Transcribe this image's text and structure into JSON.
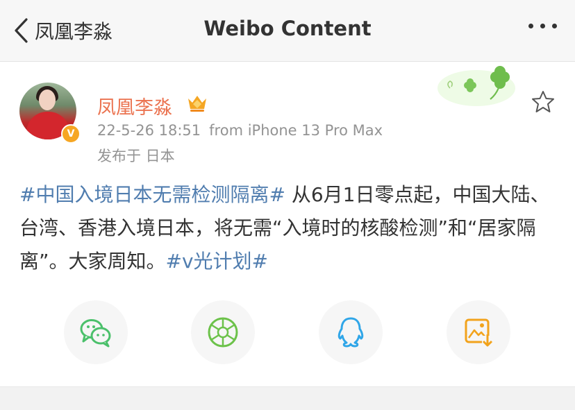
{
  "nav": {
    "back_label": "凤凰李淼",
    "title": "Weibo Content"
  },
  "post": {
    "author": "凤凰李淼",
    "timestamp": "22-5-26 18:51",
    "source": "from iPhone 13 Pro Max",
    "location": "发布于 日本",
    "verified_badge": "V",
    "content": {
      "tag1": "#中国入境日本无需检测隔离#",
      "text": " 从6月1日零点起，中国大陆、台湾、香港入境日本，将无需“入境时的核酸检测”和“居家隔离”。大家周知。",
      "tag2": "#v光计划#"
    }
  },
  "share": {
    "items": [
      {
        "icon": "wechat-icon",
        "color": "#4bc06b"
      },
      {
        "icon": "moments-icon",
        "color": "#6cc24a"
      },
      {
        "icon": "qq-icon",
        "color": "#30a6e8"
      },
      {
        "icon": "save-image-icon",
        "color": "#f2a31c"
      }
    ]
  },
  "colors": {
    "username": "#eb7350",
    "topic": "#507daf",
    "meta": "#939393"
  }
}
